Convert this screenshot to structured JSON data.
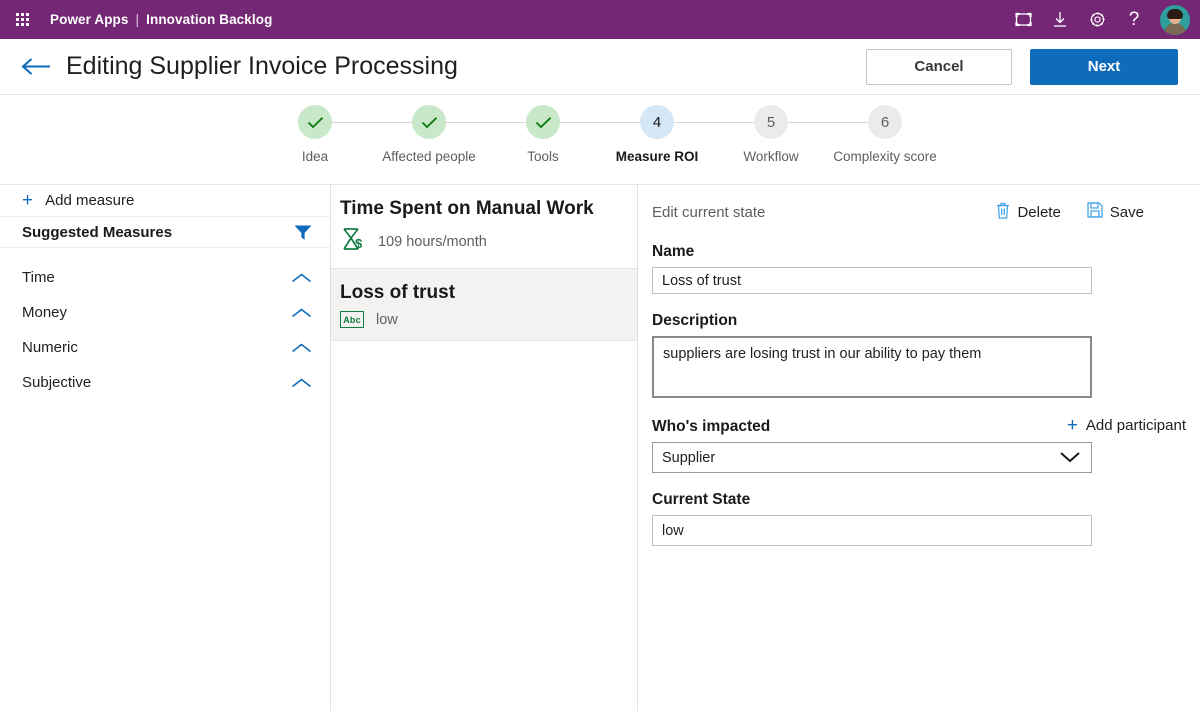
{
  "suitebar": {
    "waffle_label": "app-launcher",
    "brand": "Power Apps",
    "separator": "|",
    "app_name": "Innovation Backlog",
    "icons": [
      {
        "name": "fullscreen-icon",
        "label": "Fullscreen"
      },
      {
        "name": "download-icon",
        "label": "Download"
      },
      {
        "name": "gear-icon",
        "label": "Settings"
      },
      {
        "name": "help-icon",
        "label": "Help"
      }
    ],
    "avatar_label": "User account"
  },
  "header": {
    "back_label": "Back",
    "title": "Editing Supplier Invoice Processing",
    "cancel_label": "Cancel",
    "next_label": "Next"
  },
  "stepper": {
    "steps": [
      {
        "number": "1",
        "label": "Idea",
        "state": "done",
        "mark": "✓"
      },
      {
        "number": "2",
        "label": "Affected people",
        "state": "done",
        "mark": "✓"
      },
      {
        "number": "3",
        "label": "Tools",
        "state": "done",
        "mark": "✓"
      },
      {
        "number": "4",
        "label": "Measure ROI",
        "state": "active",
        "mark": "4"
      },
      {
        "number": "5",
        "label": "Workflow",
        "state": "todo",
        "mark": "5"
      },
      {
        "number": "6",
        "label": "Complexity score",
        "state": "todo",
        "mark": "6"
      }
    ]
  },
  "sidebar": {
    "add_measure_label": "Add measure",
    "suggested_title": "Suggested Measures",
    "filter_label": "Filter",
    "categories": [
      {
        "label": "Time",
        "expanded": true
      },
      {
        "label": "Money",
        "expanded": true
      },
      {
        "label": "Numeric",
        "expanded": true
      },
      {
        "label": "Subjective",
        "expanded": true
      }
    ]
  },
  "measures": [
    {
      "name": "Time Spent on Manual Work",
      "value": "109 hours/month",
      "icon": "hourglass-money-icon",
      "selected": false
    },
    {
      "name": "Loss of trust",
      "value": "low",
      "icon": "abc-text-icon",
      "selected": true
    }
  ],
  "detail": {
    "section_title": "Edit current state",
    "delete_label": "Delete",
    "save_label": "Save",
    "name_label": "Name",
    "name_value": "Loss of trust",
    "name_placeholder": "Name",
    "description_label": "Description",
    "description_value": "suppliers are losing trust in our ability to pay them",
    "description_placeholder": "Description",
    "impacted_label": "Who's impacted",
    "add_participant_label": "Add participant",
    "impacted_value": "Supplier",
    "impacted_options": [
      "Supplier"
    ],
    "current_state_label": "Current State",
    "current_state_value": "low",
    "current_state_placeholder": "Current State"
  },
  "colors": {
    "suite_purple": "#742774",
    "accent_blue": "#0f6cbd",
    "step_done_bg": "#c9e7c9",
    "step_done_mark": "#107c10",
    "step_active_bg": "#d4e7f7",
    "step_todo_bg": "#ebebeb",
    "measure_green": "#107c41",
    "selected_row_bg": "#f3f2f1"
  }
}
